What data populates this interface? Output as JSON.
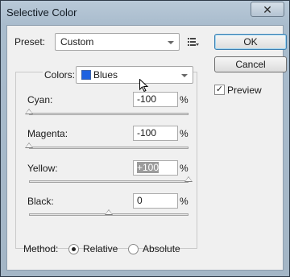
{
  "window": {
    "title": "Selective Color",
    "close_symbol": "✕"
  },
  "preset": {
    "label": "Preset:",
    "value": "Custom"
  },
  "buttons": {
    "ok": "OK",
    "cancel": "Cancel"
  },
  "preview": {
    "label": "Preview",
    "checked": true
  },
  "colors": {
    "label": "Colors:",
    "value": "Blues",
    "swatch_color": "#1f62e0"
  },
  "sliders": [
    {
      "label": "Cyan:",
      "value": "-100",
      "percent": "%",
      "level": -100
    },
    {
      "label": "Magenta:",
      "value": "-100",
      "percent": "%",
      "level": -100
    },
    {
      "label": "Yellow:",
      "value": "+100",
      "percent": "%",
      "level": 100
    },
    {
      "label": "Black:",
      "value": "0",
      "percent": "%",
      "level": 0
    }
  ],
  "method": {
    "label": "Method:",
    "options": [
      {
        "label": "Relative",
        "selected": true
      },
      {
        "label": "Absolute",
        "selected": false
      }
    ]
  }
}
